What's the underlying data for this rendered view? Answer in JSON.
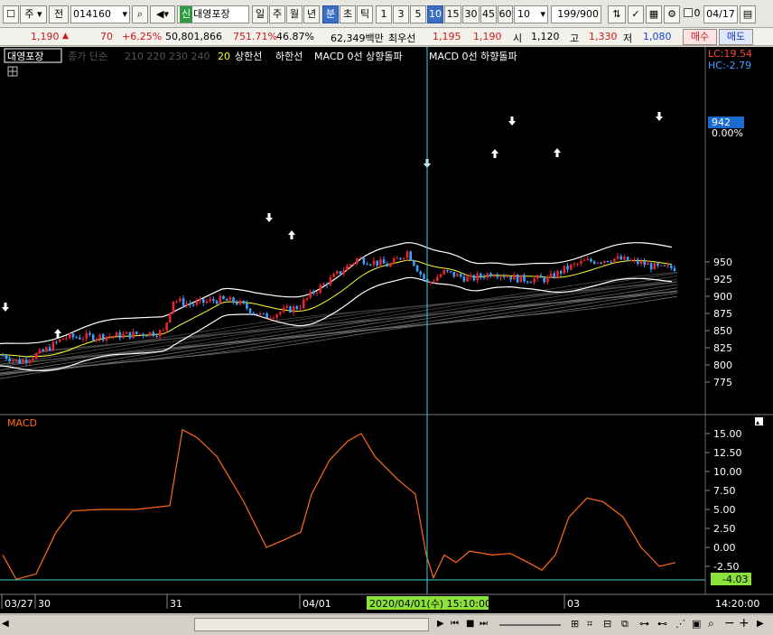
{
  "toolbar": {
    "market": "주",
    "prev": "전",
    "code": "014160",
    "new_badge": "신",
    "stock_name": "대영포장",
    "period_day": "일",
    "period_week": "주",
    "period_month": "월",
    "period_year": "년",
    "period_minute": "분",
    "period_second": "초",
    "period_tick": "틱",
    "intervals": [
      "1",
      "3",
      "5",
      "10",
      "15",
      "30",
      "45",
      "60"
    ],
    "selected_interval": "10",
    "interval_value": "10",
    "count": "199",
    "count_total": "/900",
    "checkbox_value": "0",
    "date": "04/17"
  },
  "quote": {
    "price": "1,190",
    "up_arrow": "▲",
    "change": "70",
    "change_pct": "+6.25%",
    "volume": "50,801,866",
    "volume_ratio": "751.71%",
    "turnover": "46.87%",
    "amount": "62,349백만",
    "best_bid_label": "최우선",
    "best_ask": "1,195",
    "best_bid": "1,190",
    "open_label": "시",
    "open": "1,120",
    "high_label": "고",
    "high": "1,330",
    "low_label": "저",
    "low": "1,080",
    "buy": "매수",
    "sell": "매도"
  },
  "legend": {
    "stock": "대영포장",
    "close_simple": "종가 단순",
    "ma_list": "210  220  230  240",
    "ma20": "20",
    "upper_band": "상한선",
    "lower_band": "하한선",
    "macd_up": "MACD 0선 상향돌파",
    "macd_down": "MACD 0선 하향돌파"
  },
  "axis": {
    "lc": "LC:19.54",
    "hc": "HC:-2.79",
    "price_ticks": [
      "950",
      "925",
      "900",
      "875",
      "850",
      "825",
      "800",
      "775"
    ],
    "current_price": "942",
    "current_pct": "0.00%",
    "macd_ticks": [
      "15.00",
      "12.50",
      "10.00",
      "7.50",
      "5.00",
      "2.50",
      "0.00",
      "-2.50"
    ],
    "macd_current": "-4.03"
  },
  "macd_panel": {
    "title": "MACD"
  },
  "time_axis": {
    "labels": [
      "03/27",
      "30",
      "31",
      "04/01",
      "03"
    ],
    "cursor_label": "2020/04/01(수) 15:10:00",
    "right_label": "14:20:00"
  },
  "colors": {
    "chart_bg": "#000000",
    "candle_up": "#e8242a",
    "candle_down": "#3aa0ff",
    "ma20": "#ffff2a",
    "band": "#ffffff",
    "macd": "#ff6a1a",
    "cursor": "#40d0d0",
    "macd_label_bg": "#8ce03a"
  }
}
